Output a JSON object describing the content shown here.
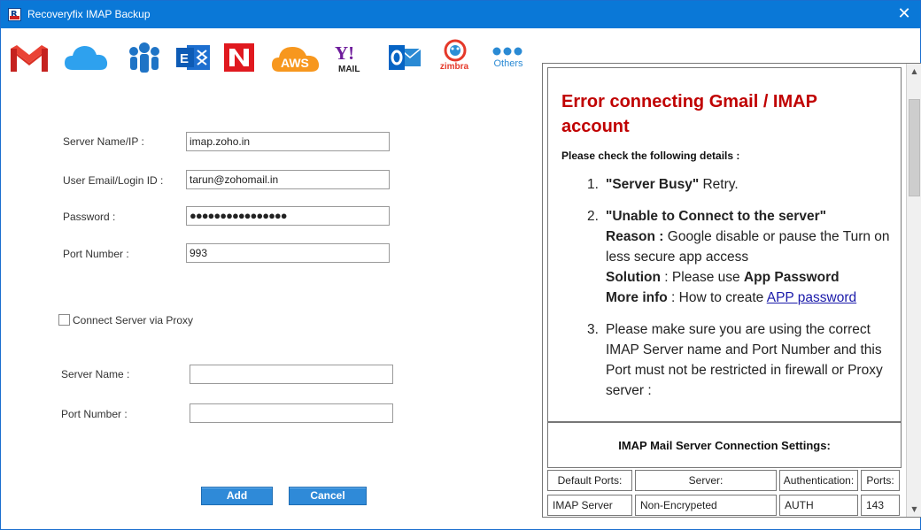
{
  "window": {
    "title": "Recoveryfix IMAP Backup",
    "close_glyph": "✕",
    "app_icon_letter": "R"
  },
  "providers": [
    {
      "id": "gmail",
      "icon": "gmail-icon"
    },
    {
      "id": "icloud",
      "icon": "icloud-icon"
    },
    {
      "id": "lotus",
      "icon": "lotus-notes-icon"
    },
    {
      "id": "exchange",
      "icon": "exchange-icon"
    },
    {
      "id": "novell",
      "icon": "novell-icon"
    },
    {
      "id": "aws",
      "icon": "aws-icon",
      "label": "AWS"
    },
    {
      "id": "yahoo",
      "icon": "yahoo-mail-icon",
      "label": "Y!",
      "sub": "MAIL"
    },
    {
      "id": "outlook",
      "icon": "outlook-icon"
    },
    {
      "id": "zimbra",
      "icon": "zimbra-icon",
      "label": "zimbra"
    },
    {
      "id": "others",
      "icon": "others-icon",
      "label": "Others"
    }
  ],
  "form": {
    "server_label": "Server Name/IP :",
    "server_value": "imap.zoho.in",
    "email_label": "User Email/Login ID :",
    "email_value": "tarun@zohomail.in",
    "password_label": "Password :",
    "password_value": "●●●●●●●●●●●●●●●●",
    "port_label": "Port Number :",
    "port_value": "993",
    "proxy_label": "Connect Server via Proxy",
    "proxy_checked": false,
    "proxy_server_label": "Server Name :",
    "proxy_server_value": "",
    "proxy_port_label": "Port Number :",
    "proxy_port_value": "",
    "add_label": "Add",
    "cancel_label": "Cancel"
  },
  "error_panel": {
    "title": "Error connecting Gmail / IMAP account",
    "check_line": "Please check the following details :",
    "item1_num": "1.",
    "item1_bold": "\"Server Busy\"",
    "item1_rest": " Retry.",
    "item2_num": "2.",
    "item2_head": "\"Unable to Connect to the server\"",
    "item2_reason_label": "Reason :",
    "item2_reason": " Google disable or pause the Turn on less secure app access",
    "item2_solution_label": "Solution",
    "item2_solution_mid": " : Please use ",
    "item2_solution_bold": "App Password",
    "item2_more_label": "More info",
    "item2_more_mid": " : How to create ",
    "item2_link": "APP password",
    "item3_num": "3.",
    "item3_text": "Please make sure you are using the correct IMAP Server name and Port Number and this Port must not be restricted in firewall or Proxy server :",
    "settings_title": "IMAP Mail Server Connection Settings:",
    "table": {
      "headers": [
        "Default Ports:",
        "Server:",
        "Authentication:",
        "Ports:"
      ],
      "rows": [
        [
          "IMAP Server",
          "Non-Encrypeted",
          "AUTH",
          "143"
        ]
      ]
    }
  },
  "colors": {
    "titlebar": "#0a78d7",
    "error_title": "#c00000",
    "button": "#2f8ad8",
    "link": "#1a1aaa"
  }
}
